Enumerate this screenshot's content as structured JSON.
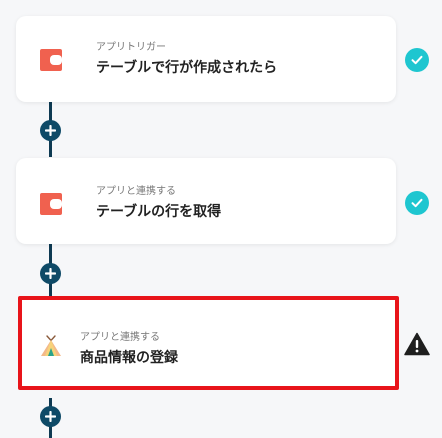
{
  "colors": {
    "background": "#f6f7f9",
    "connector": "#0e3a52",
    "plus_button": "#0e4a67",
    "check": "#1ec6d0",
    "selected_border": "#e8141a",
    "app_icon": "#f0614f"
  },
  "steps": [
    {
      "subtitle": "アプリトリガー",
      "title": "テーブルで行が作成されたら",
      "icon": "table-app-icon",
      "status": "check-circle-icon"
    },
    {
      "subtitle": "アプリと連携する",
      "title": "テーブルの行を取得",
      "icon": "table-app-icon",
      "status": "check-circle-icon"
    },
    {
      "subtitle": "アプリと連携する",
      "title": "商品情報の登録",
      "icon": "tent-app-icon",
      "status": "warning-icon",
      "selected": true
    }
  ],
  "add_buttons": [
    {
      "icon": "plus-icon"
    },
    {
      "icon": "plus-icon"
    },
    {
      "icon": "plus-icon"
    }
  ]
}
